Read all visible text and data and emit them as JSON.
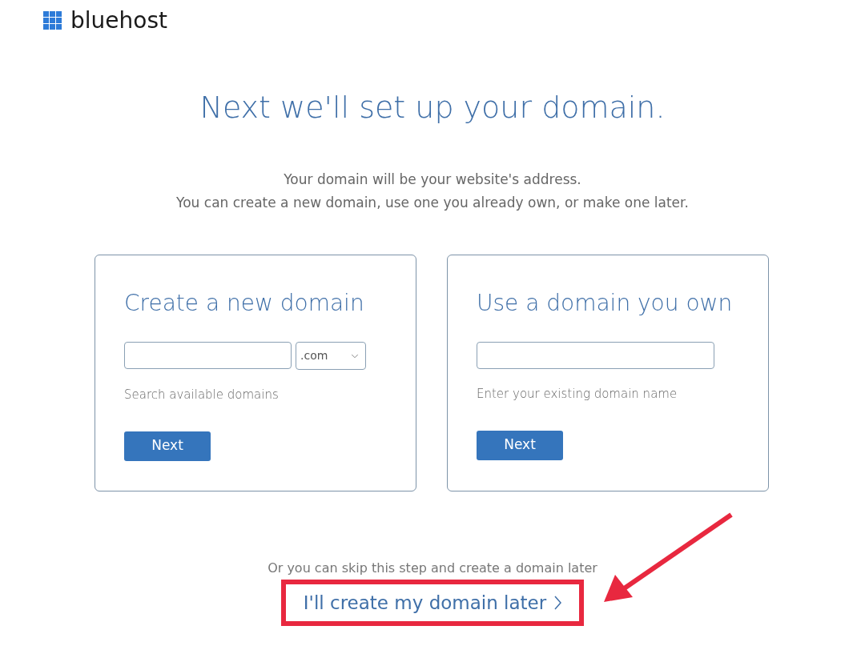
{
  "logo": {
    "text": "bluehost"
  },
  "heading": "Next we'll set up your domain.",
  "intro": [
    "Your domain will be your website's address.",
    "You can create a new domain, use one you already own, or make one later."
  ],
  "cards": [
    {
      "title": "Create a new domain",
      "kind": "search",
      "select_value": ".com",
      "helper": "Search available domains",
      "button": "Next"
    },
    {
      "title": "Use a domain you own",
      "kind": "existing",
      "helper": "Enter your existing domain name",
      "button": "Next"
    }
  ],
  "skip": {
    "text": "Or you can skip this step and create a domain later",
    "link": "I'll create my domain later",
    "highlighted": true
  }
}
